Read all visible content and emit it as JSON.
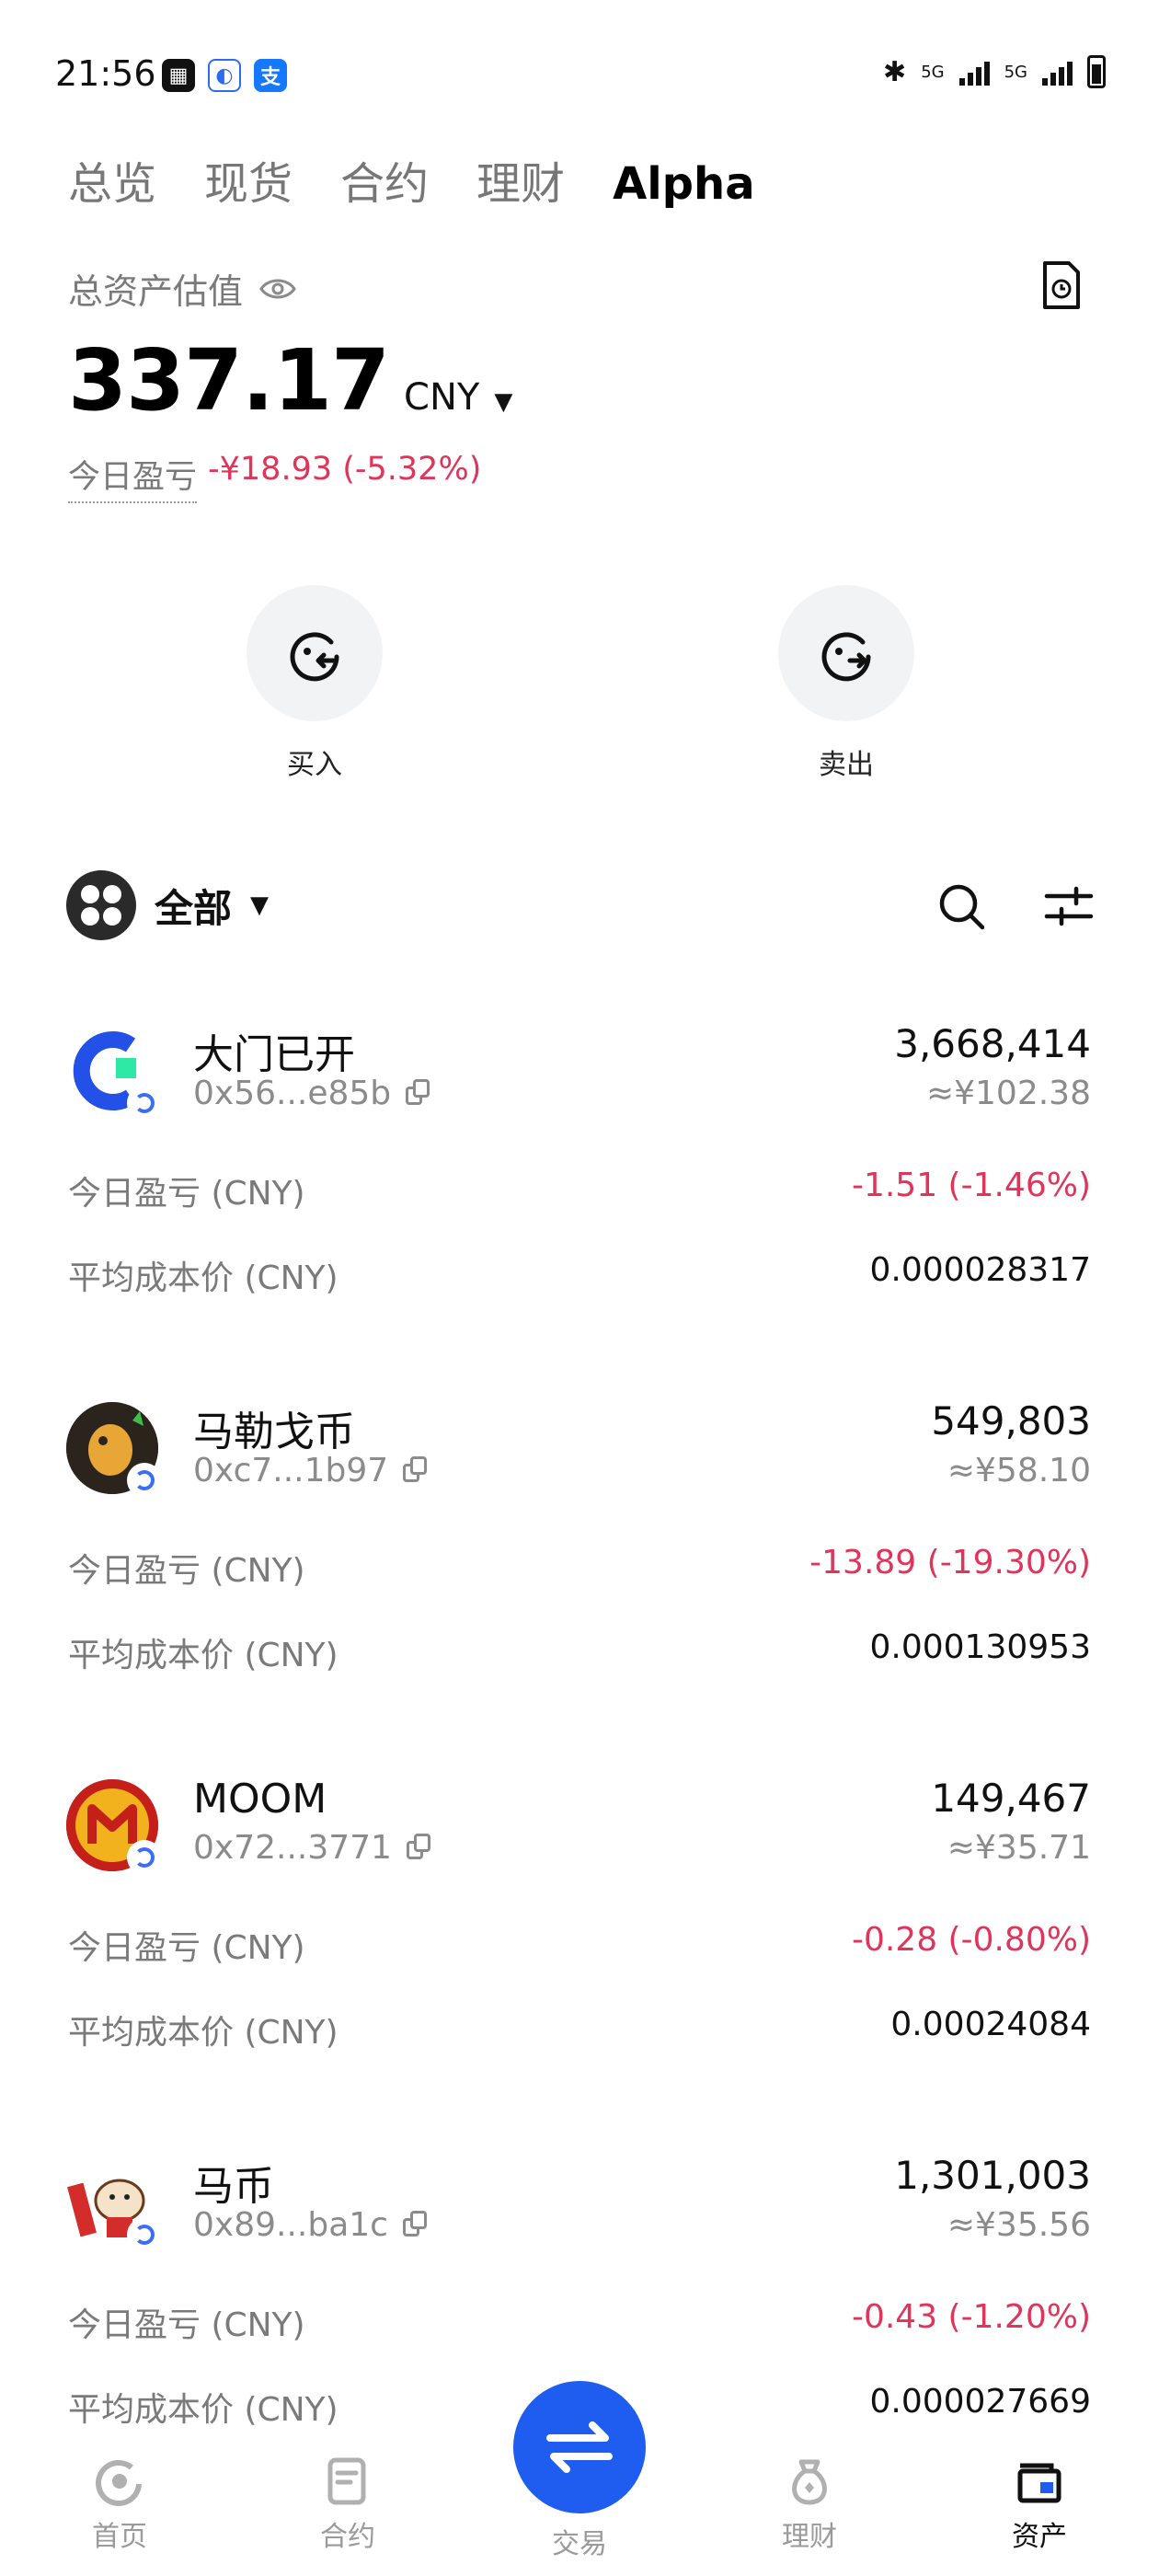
{
  "status": {
    "time": "21:56",
    "net1": "5G",
    "net2": "5G"
  },
  "tabs": [
    "总览",
    "现货",
    "合约",
    "理财",
    "Alpha"
  ],
  "overview": {
    "label": "总资产估值",
    "total_value": "337.17",
    "currency": "CNY",
    "pnl_label": "今日盈亏",
    "pnl_value": "-¥18.93 (-5.32%)"
  },
  "actions": {
    "buy": "买入",
    "sell": "卖出"
  },
  "filter": {
    "label": "全部"
  },
  "row_labels": {
    "pnl": "今日盈亏 (CNY)",
    "avg_cost": "平均成本价 (CNY)"
  },
  "tokens": [
    {
      "name": "大门已开",
      "address": "0x56...e85b",
      "amount": "3,668,414",
      "est": "≈¥102.38",
      "pnl": "-1.51 (-1.46%)",
      "avg_cost": "0.000028317"
    },
    {
      "name": "马勒戈币",
      "address": "0xc7...1b97",
      "amount": "549,803",
      "est": "≈¥58.10",
      "pnl": "-13.89 (-19.30%)",
      "avg_cost": "0.000130953"
    },
    {
      "name": "MOOM",
      "address": "0x72...3771",
      "amount": "149,467",
      "est": "≈¥35.71",
      "pnl": "-0.28 (-0.80%)",
      "avg_cost": "0.00024084"
    },
    {
      "name": "马币",
      "address": "0x89...ba1c",
      "amount": "1,301,003",
      "est": "≈¥35.56",
      "pnl": "-0.43 (-1.20%)",
      "avg_cost": "0.000027669"
    }
  ],
  "nav": [
    "首页",
    "合约",
    "交易",
    "理财",
    "资产"
  ],
  "colors": {
    "negative": "#e0355a",
    "accent": "#1f5cf0"
  }
}
